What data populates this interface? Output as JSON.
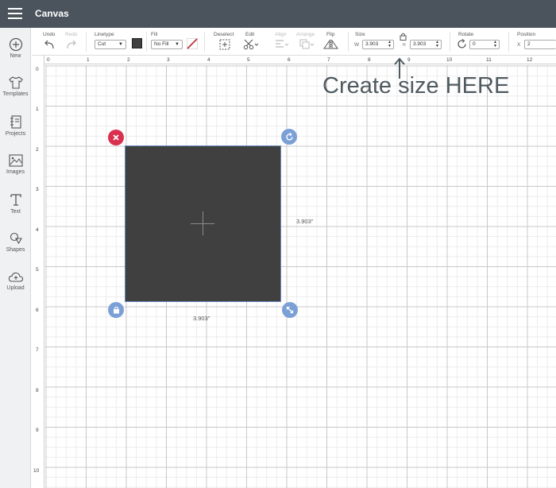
{
  "app": {
    "title": "Canvas"
  },
  "sidebar": {
    "items": [
      {
        "label": "New",
        "icon": "plus-circle-icon"
      },
      {
        "label": "Templates",
        "icon": "shirt-icon"
      },
      {
        "label": "Projects",
        "icon": "notebook-icon"
      },
      {
        "label": "Images",
        "icon": "image-icon"
      },
      {
        "label": "Text",
        "icon": "text-T-icon"
      },
      {
        "label": "Shapes",
        "icon": "shapes-icon"
      },
      {
        "label": "Upload",
        "icon": "cloud-upload-icon"
      }
    ]
  },
  "toolbar": {
    "undo": "Undo",
    "redo": "Redo",
    "linetype_label": "Linetype",
    "linetype_value": "Cut",
    "fill_label": "Fill",
    "fill_value": "No Fill",
    "deselect": "Deselect",
    "edit": "Edit",
    "align": "Align",
    "arrange": "Arrange",
    "flip": "Flip",
    "size_label": "Size",
    "w_label": "W",
    "w_value": "3.903",
    "h_label": "H",
    "h_value": "3.903",
    "rotate_label": "Rotate",
    "rotate_value": "0",
    "position_label": "Position",
    "x_label": "X",
    "x_value": "2",
    "colors": {
      "swatch": "#404040",
      "nofill_slash": "#c0282d"
    }
  },
  "rulers": {
    "horizontal": [
      "0",
      "1",
      "2",
      "3",
      "4",
      "5",
      "6",
      "7",
      "8",
      "9",
      "10",
      "11",
      "12"
    ],
    "vertical": [
      "0",
      "1",
      "2",
      "3",
      "4",
      "5",
      "6",
      "7",
      "8",
      "9",
      "10"
    ]
  },
  "canvas": {
    "shape_color": "#404040",
    "width_dimension": "3.903\"",
    "height_dimension": "3.903\"",
    "handle_colors": {
      "delete": "#d9304f",
      "other": "#7ba0d6"
    }
  },
  "annotation": {
    "text": "Create size HERE"
  }
}
